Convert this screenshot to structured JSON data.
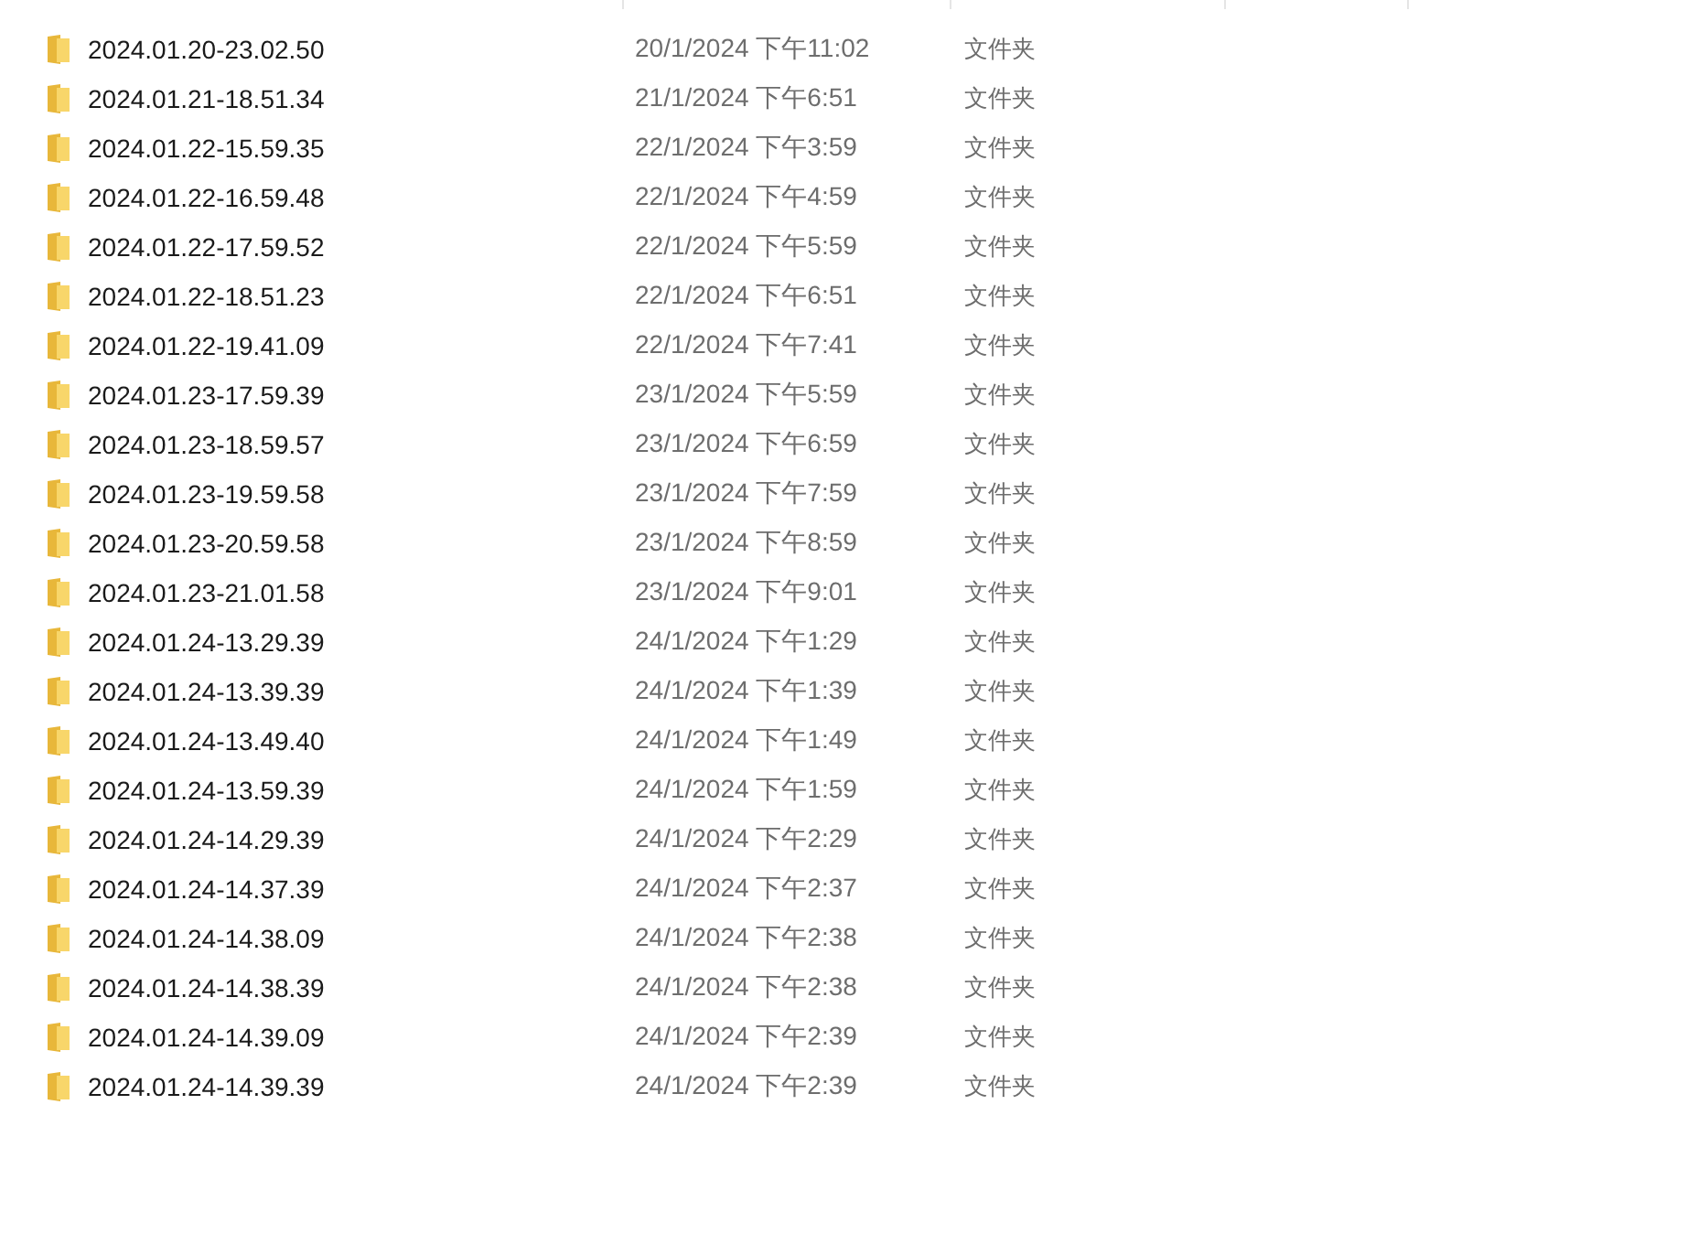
{
  "files": [
    {
      "name": "2024.01.20-23.02.50",
      "date": "20/1/2024 下午11:02",
      "type": "文件夹"
    },
    {
      "name": "2024.01.21-18.51.34",
      "date": "21/1/2024 下午6:51",
      "type": "文件夹"
    },
    {
      "name": "2024.01.22-15.59.35",
      "date": "22/1/2024 下午3:59",
      "type": "文件夹"
    },
    {
      "name": "2024.01.22-16.59.48",
      "date": "22/1/2024 下午4:59",
      "type": "文件夹"
    },
    {
      "name": "2024.01.22-17.59.52",
      "date": "22/1/2024 下午5:59",
      "type": "文件夹"
    },
    {
      "name": "2024.01.22-18.51.23",
      "date": "22/1/2024 下午6:51",
      "type": "文件夹"
    },
    {
      "name": "2024.01.22-19.41.09",
      "date": "22/1/2024 下午7:41",
      "type": "文件夹"
    },
    {
      "name": "2024.01.23-17.59.39",
      "date": "23/1/2024 下午5:59",
      "type": "文件夹"
    },
    {
      "name": "2024.01.23-18.59.57",
      "date": "23/1/2024 下午6:59",
      "type": "文件夹"
    },
    {
      "name": "2024.01.23-19.59.58",
      "date": "23/1/2024 下午7:59",
      "type": "文件夹"
    },
    {
      "name": "2024.01.23-20.59.58",
      "date": "23/1/2024 下午8:59",
      "type": "文件夹"
    },
    {
      "name": "2024.01.23-21.01.58",
      "date": "23/1/2024 下午9:01",
      "type": "文件夹"
    },
    {
      "name": "2024.01.24-13.29.39",
      "date": "24/1/2024 下午1:29",
      "type": "文件夹"
    },
    {
      "name": "2024.01.24-13.39.39",
      "date": "24/1/2024 下午1:39",
      "type": "文件夹"
    },
    {
      "name": "2024.01.24-13.49.40",
      "date": "24/1/2024 下午1:49",
      "type": "文件夹"
    },
    {
      "name": "2024.01.24-13.59.39",
      "date": "24/1/2024 下午1:59",
      "type": "文件夹"
    },
    {
      "name": "2024.01.24-14.29.39",
      "date": "24/1/2024 下午2:29",
      "type": "文件夹"
    },
    {
      "name": "2024.01.24-14.37.39",
      "date": "24/1/2024 下午2:37",
      "type": "文件夹"
    },
    {
      "name": "2024.01.24-14.38.09",
      "date": "24/1/2024 下午2:38",
      "type": "文件夹"
    },
    {
      "name": "2024.01.24-14.38.39",
      "date": "24/1/2024 下午2:38",
      "type": "文件夹"
    },
    {
      "name": "2024.01.24-14.39.09",
      "date": "24/1/2024 下午2:39",
      "type": "文件夹"
    },
    {
      "name": "2024.01.24-14.39.39",
      "date": "24/1/2024 下午2:39",
      "type": "文件夹"
    }
  ]
}
